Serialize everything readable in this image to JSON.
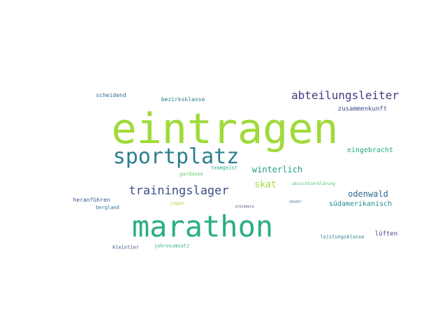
{
  "words": [
    {
      "text": "eintragen",
      "color": "#a0da39"
    },
    {
      "text": "marathon",
      "color": "#29af7f"
    },
    {
      "text": "sportplatz",
      "color": "#2c7e8e"
    },
    {
      "text": "abteilungsleiter",
      "color": "#453882"
    },
    {
      "text": "trainingslager",
      "color": "#3d4e8a"
    },
    {
      "text": "winterlich",
      "color": "#1fa187"
    },
    {
      "text": "skat",
      "color": "#a2da37"
    },
    {
      "text": "odenwald",
      "color": "#31688e"
    },
    {
      "text": "südamerikanisch",
      "color": "#228c8d"
    },
    {
      "text": "eingebracht",
      "color": "#22a884"
    },
    {
      "text": "zusammenkunft",
      "color": "#3e4a89"
    },
    {
      "text": "scheidend",
      "color": "#31688e"
    },
    {
      "text": "bezirksklasse",
      "color": "#2a7b8e"
    },
    {
      "text": "lüften",
      "color": "#443a83"
    },
    {
      "text": "teamgeist",
      "color": "#22a785"
    },
    {
      "text": "gardasee",
      "color": "#5ec962"
    },
    {
      "text": "heranführen",
      "color": "#3a548c"
    },
    {
      "text": "bergland",
      "color": "#31688e"
    },
    {
      "text": "jogger",
      "color": "#a8db34"
    },
    {
      "text": "steinmole",
      "color": "#443983"
    },
    {
      "text": "skater",
      "color": "#39558c"
    },
    {
      "text": "absichtserklärung",
      "color": "#4ac16d"
    },
    {
      "text": "leistungsklasse",
      "color": "#26828e"
    },
    {
      "text": "kleintier",
      "color": "#3b528b"
    },
    {
      "text": "jahresumsatz",
      "color": "#2fb47c"
    }
  ]
}
